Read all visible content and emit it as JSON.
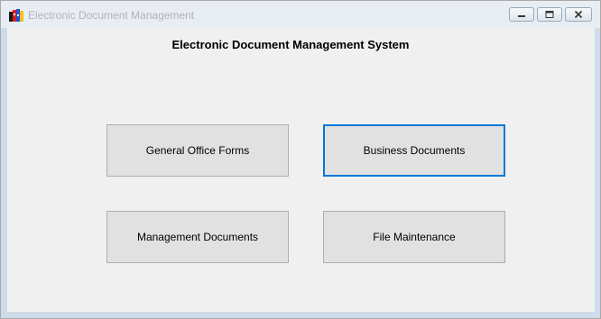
{
  "window": {
    "title": "Electronic Document Management",
    "controls": [
      "minimize-icon",
      "restore-icon",
      "close-icon"
    ]
  },
  "main": {
    "heading": "Electronic Document Management System",
    "buttons": [
      {
        "label": "General Office Forms"
      },
      {
        "label": "Business Documents",
        "focused": true
      },
      {
        "label": "Management Documents"
      },
      {
        "label": "File Maintenance"
      }
    ]
  },
  "colors": {
    "focus_border": "#0078d7",
    "button_face": "#e1e1e1",
    "client_background": "#f0f0f0"
  }
}
